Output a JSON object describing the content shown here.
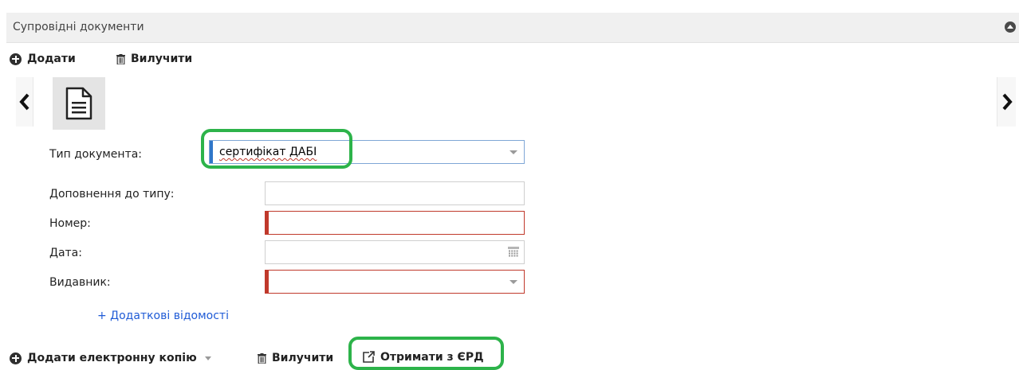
{
  "section": {
    "title": "Супровідні документи"
  },
  "toolbar_top": {
    "add_label": "Додати",
    "remove_label": "Вилучити"
  },
  "form": {
    "doc_type": {
      "label": "Тип документа:",
      "value": "сертифікат ДАБІ"
    },
    "type_addition": {
      "label": "Доповнення до типу:",
      "value": ""
    },
    "number": {
      "label": "Номер:",
      "value": ""
    },
    "date": {
      "label": "Дата:",
      "value": ""
    },
    "issuer": {
      "label": "Видавник:",
      "value": ""
    }
  },
  "links": {
    "additional_info": "+ Додаткові відомості"
  },
  "toolbar_bottom": {
    "add_copy_label": "Додати електронну копію",
    "remove_label": "Вилучити",
    "get_from_erd_label": "Отримати з ЄРД"
  },
  "colors": {
    "highlight": "#2db34a",
    "required": "#c0392b",
    "focus_bar": "#2f76c9",
    "link": "#1f5bd6"
  }
}
